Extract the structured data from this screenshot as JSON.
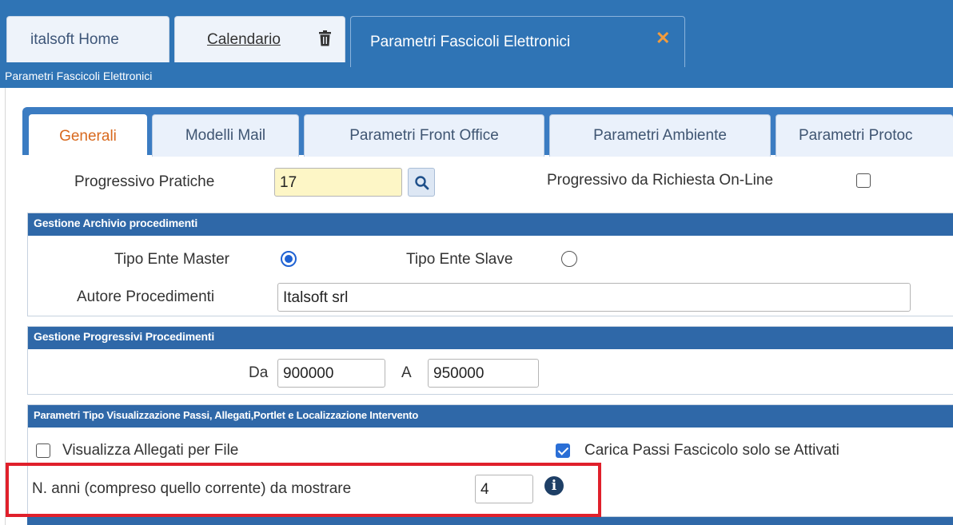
{
  "top_tabs": {
    "home": "italsoft Home",
    "calendar": "Calendario",
    "active": "Parametri Fascicoli Elettronici",
    "close_symbol": "✕"
  },
  "window_title": "Parametri Fascicoli Elettronici",
  "inner_tabs": [
    "Generali",
    "Modelli Mail",
    "Parametri Front Office",
    "Parametri Ambiente",
    "Parametri Protoc"
  ],
  "general": {
    "progressivo_label": "Progressivo Pratiche",
    "progressivo_value": "17",
    "online_label": "Progressivo da Richiesta On-Line",
    "online_checked": false
  },
  "archivio": {
    "title": "Gestione Archivio procedimenti",
    "master_label": "Tipo Ente Master",
    "master_selected": true,
    "slave_label": "Tipo Ente Slave",
    "slave_selected": false,
    "autore_label": "Autore Procedimenti",
    "autore_value": "Italsoft srl"
  },
  "progressivi": {
    "title": "Gestione Progressivi Procedimenti",
    "from_label": "Da",
    "from_value": "900000",
    "to_label": "A",
    "to_value": "950000"
  },
  "visualizzazione": {
    "title": "Parametri Tipo Visualizzazione Passi, Allegati,Portlet e Localizzazione Intervento",
    "allegati_label": "Visualizza Allegati per File",
    "allegati_checked": false,
    "carica_label": "Carica Passi Fascicolo solo se Attivati",
    "carica_checked": true,
    "anni_label": "N. anni (compreso quello corrente) da mostrare",
    "anni_value": "4",
    "info_symbol": "i"
  },
  "colors": {
    "header_blue": "#2f74b5",
    "section_blue": "#2f68a8",
    "active_tab_text": "#d8691e",
    "highlight_red": "#e0202b"
  }
}
